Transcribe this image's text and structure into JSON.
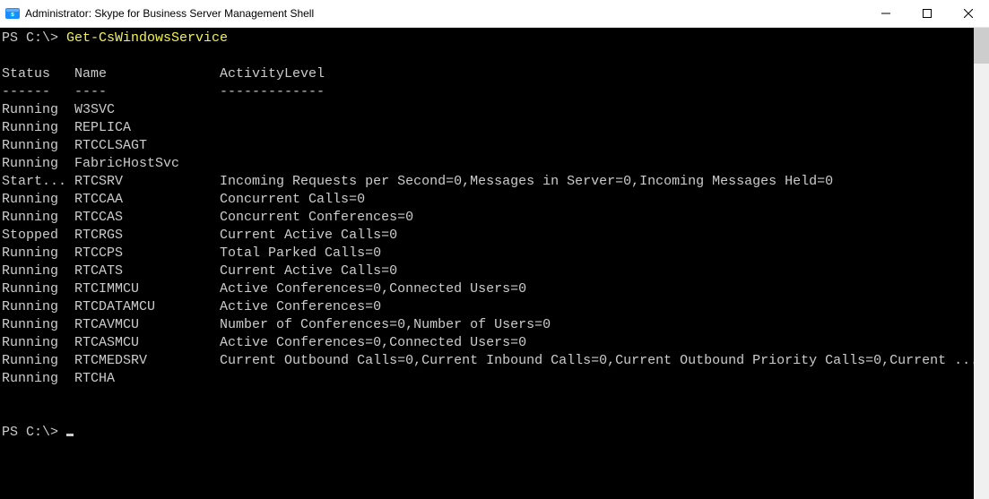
{
  "window": {
    "title": "Administrator: Skype for Business Server Management Shell"
  },
  "terminal": {
    "promptPrefix": "PS C:\\> ",
    "command": "Get-CsWindowsService",
    "cols": {
      "status": "Status",
      "name": "Name",
      "activity": "ActivityLevel"
    },
    "dashes": {
      "status": "------",
      "name": "----",
      "activity": "-------------"
    },
    "rows": [
      {
        "status": "Running",
        "name": "W3SVC",
        "activity": ""
      },
      {
        "status": "Running",
        "name": "REPLICA",
        "activity": ""
      },
      {
        "status": "Running",
        "name": "RTCCLSAGT",
        "activity": ""
      },
      {
        "status": "Running",
        "name": "FabricHostSvc",
        "activity": ""
      },
      {
        "status": "Start...",
        "name": "RTCSRV",
        "activity": "Incoming Requests per Second=0,Messages in Server=0,Incoming Messages Held=0"
      },
      {
        "status": "Running",
        "name": "RTCCAA",
        "activity": "Concurrent Calls=0"
      },
      {
        "status": "Running",
        "name": "RTCCAS",
        "activity": "Concurrent Conferences=0"
      },
      {
        "status": "Stopped",
        "name": "RTCRGS",
        "activity": "Current Active Calls=0"
      },
      {
        "status": "Running",
        "name": "RTCCPS",
        "activity": "Total Parked Calls=0"
      },
      {
        "status": "Running",
        "name": "RTCATS",
        "activity": "Current Active Calls=0"
      },
      {
        "status": "Running",
        "name": "RTCIMMCU",
        "activity": "Active Conferences=0,Connected Users=0"
      },
      {
        "status": "Running",
        "name": "RTCDATAMCU",
        "activity": "Active Conferences=0"
      },
      {
        "status": "Running",
        "name": "RTCAVMCU",
        "activity": "Number of Conferences=0,Number of Users=0"
      },
      {
        "status": "Running",
        "name": "RTCASMCU",
        "activity": "Active Conferences=0,Connected Users=0"
      },
      {
        "status": "Running",
        "name": "RTCMEDSRV",
        "activity": "Current Outbound Calls=0,Current Inbound Calls=0,Current Outbound Priority Calls=0,Current ..."
      },
      {
        "status": "Running",
        "name": "RTCHA",
        "activity": ""
      }
    ],
    "finalPrompt": "PS C:\\> "
  }
}
